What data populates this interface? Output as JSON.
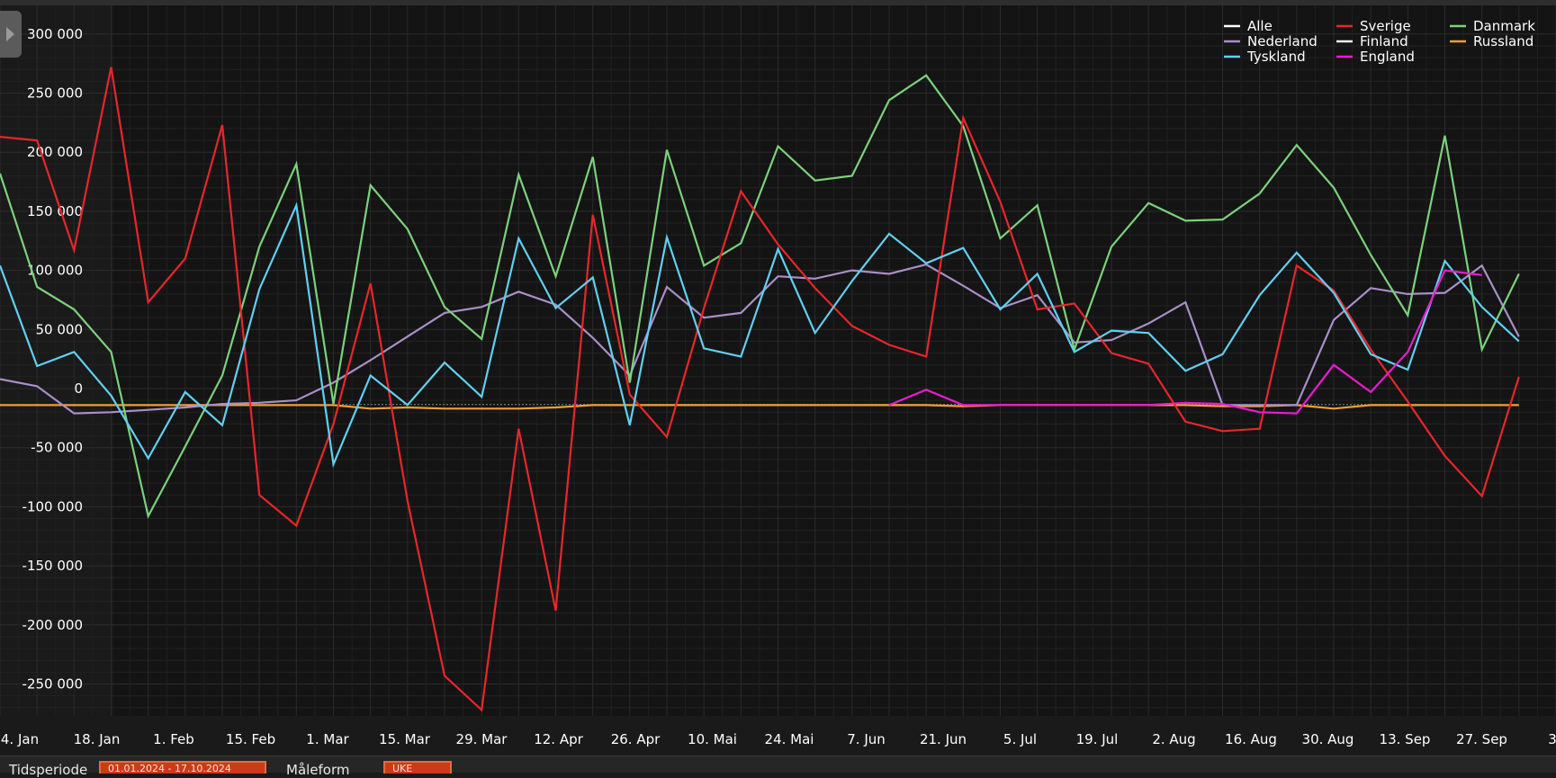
{
  "chart_data": {
    "type": "line",
    "title": "",
    "xlabel": "",
    "ylabel": "",
    "ylim": [
      -290000,
      310000
    ],
    "grid": true,
    "legend_position": "top-right",
    "y_ticks": [
      300000,
      250000,
      200000,
      150000,
      100000,
      50000,
      0,
      -50000,
      -100000,
      -150000,
      -200000,
      -250000
    ],
    "y_tick_labels": [
      "300 000",
      "250 000",
      "200 000",
      "150 000",
      "100 000",
      "50 000",
      "0",
      "-50 000",
      "-100 000",
      "-150 000",
      "-200 000",
      "-250 000"
    ],
    "x_tick_labels": [
      "4. Jan",
      "18. Jan",
      "1. Feb",
      "15. Feb",
      "1. Mar",
      "15. Mar",
      "29. Mar",
      "12. Apr",
      "26. Apr",
      "10. Mai",
      "24. Mai",
      "7. Jun",
      "21. Jun",
      "5. Jul",
      "19. Jul",
      "2. Aug",
      "16. Aug",
      "30. Aug",
      "13. Sep",
      "27. Sep",
      "3. J"
    ],
    "x": [
      "1. Jan",
      "8. Jan",
      "15. Jan",
      "22. Jan",
      "29. Jan",
      "5. Feb",
      "12. Feb",
      "19. Feb",
      "26. Feb",
      "4. Mar",
      "11. Mar",
      "18. Mar",
      "25. Mar",
      "1. Apr",
      "8. Apr",
      "15. Apr",
      "22. Apr",
      "29. Apr",
      "6. Mai",
      "13. Mai",
      "20. Mai",
      "27. Mai",
      "3. Jun",
      "10. Jun",
      "17. Jun",
      "24. Jun",
      "1. Jul",
      "8. Jul",
      "15. Jul",
      "22. Jul",
      "29. Jul",
      "5. Aug",
      "12. Aug",
      "19. Aug",
      "26. Aug",
      "2. Sep",
      "9. Sep",
      "16. Sep",
      "23. Sep",
      "30. Sep",
      "7. Okt",
      "14. Okt",
      "21. Okt"
    ],
    "series": [
      {
        "name": "Alle",
        "color": "#ffffff",
        "values": []
      },
      {
        "name": "Sverige",
        "color": "#e8262a",
        "values": [
          213000,
          210000,
          117000,
          272000,
          73000,
          110000,
          223000,
          -90000,
          -116000,
          -30000,
          89000,
          -95000,
          -243000,
          -272000,
          -34000,
          -188000,
          147000,
          -5000,
          -41000,
          68000,
          167000,
          122000,
          85000,
          53000,
          37000,
          27000,
          229000,
          158000,
          67000,
          72000,
          30000,
          21000,
          -28000,
          -36000,
          -34000,
          104000,
          83000,
          33000,
          -11000,
          -57000,
          -91000,
          10000,
          null
        ]
      },
      {
        "name": "Danmark",
        "color": "#7cd17c",
        "values": [
          182000,
          86000,
          67000,
          31000,
          -108000,
          -49000,
          11000,
          120000,
          190000,
          -13000,
          172000,
          135000,
          69000,
          42000,
          181000,
          95000,
          196000,
          5000,
          202000,
          104000,
          123000,
          205000,
          176000,
          180000,
          244000,
          265000,
          222000,
          127000,
          155000,
          33000,
          120000,
          157000,
          142000,
          143000,
          165000,
          206000,
          170000,
          113000,
          62000,
          214000,
          33000,
          97000,
          null
        ]
      },
      {
        "name": "Nederland",
        "color": "#a98fc9",
        "values": [
          8000,
          2000,
          -21000,
          -20000,
          -18000,
          -16000,
          -13000,
          -12000,
          -10000,
          5000,
          24000,
          44000,
          64000,
          69000,
          82000,
          71000,
          43000,
          11000,
          86000,
          60000,
          64000,
          95000,
          93000,
          100000,
          97000,
          105000,
          87000,
          68000,
          79000,
          39000,
          41000,
          55000,
          73000,
          -14000,
          -14000,
          -14000,
          58000,
          85000,
          80000,
          81000,
          104000,
          44000,
          null
        ]
      },
      {
        "name": "Finland",
        "color": "#f2f2f2",
        "values": []
      },
      {
        "name": "Russland",
        "color": "#f0a030",
        "values": [
          -14000,
          -14000,
          -14000,
          -14000,
          -14000,
          -14000,
          -14000,
          -14000,
          -14000,
          -14000,
          -17000,
          -16000,
          -17000,
          -17000,
          -17000,
          -16000,
          -14000,
          -14000,
          -14000,
          -14000,
          -14000,
          -14000,
          -14000,
          -14000,
          -14000,
          -14000,
          -15000,
          -14000,
          -14000,
          -14000,
          -14000,
          -14000,
          -14000,
          -15000,
          -15000,
          -14000,
          -17000,
          -14000,
          -14000,
          -14000,
          -14000,
          -14000,
          null
        ]
      },
      {
        "name": "Tyskland",
        "color": "#62cff0",
        "values": [
          104000,
          19000,
          31000,
          -6000,
          -59000,
          -3000,
          -31000,
          84000,
          155000,
          -64000,
          11000,
          -14000,
          22000,
          -7000,
          127000,
          68000,
          94000,
          -31000,
          128000,
          34000,
          27000,
          118000,
          47000,
          91000,
          131000,
          106000,
          119000,
          67000,
          97000,
          31000,
          49000,
          47000,
          15000,
          29000,
          79000,
          115000,
          81000,
          29000,
          16000,
          108000,
          69000,
          40000,
          null
        ]
      },
      {
        "name": "England",
        "color": "#e81ccf",
        "values": [
          null,
          null,
          null,
          null,
          null,
          null,
          null,
          null,
          null,
          null,
          null,
          null,
          null,
          null,
          null,
          null,
          null,
          null,
          null,
          null,
          null,
          null,
          null,
          null,
          -14000,
          -1000,
          -14000,
          -14000,
          -14000,
          -14000,
          -14000,
          -14000,
          -12000,
          -13000,
          -20000,
          -21000,
          20000,
          -3000,
          31000,
          100000,
          96000,
          null,
          null
        ]
      }
    ]
  },
  "legend_order": [
    "Alle",
    "Sverige",
    "Danmark",
    "Nederland",
    "Finland",
    "Russland",
    "Tyskland",
    "England"
  ],
  "bottom": {
    "label1": "Tidsperiode",
    "field1": "01.01.2024 - 17.10.2024",
    "label2": "Måleform",
    "field2": "UKE"
  }
}
